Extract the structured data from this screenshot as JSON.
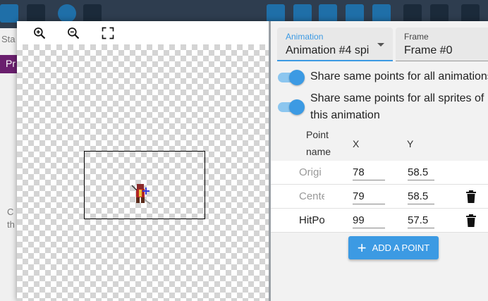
{
  "background": {
    "left_text_top": "Sta",
    "left_purple_text": "Pr",
    "left_text_bottom": "C\nth"
  },
  "preview": {
    "toolbar": [
      {
        "name": "zoom-in-icon"
      },
      {
        "name": "zoom-out-icon"
      },
      {
        "name": "fit-screen-icon"
      }
    ]
  },
  "animation_select": {
    "label": "Animation",
    "value": "Animation #4 spi"
  },
  "frame_select": {
    "label": "Frame",
    "value": "Frame #0"
  },
  "toggles": [
    {
      "label": "Share same points for all animations",
      "on": true
    },
    {
      "label_line1": "Share same points for all sprites of",
      "label_line2": "this animation",
      "on": true
    }
  ],
  "table": {
    "headers": {
      "name_line1": "Point",
      "name_line2": "name",
      "x": "X",
      "y": "Y"
    },
    "rows": [
      {
        "name": "Origi",
        "x": "78",
        "y": "58.5",
        "deletable": false,
        "muted": true
      },
      {
        "name": "Cente",
        "x": "79",
        "y": "58.5",
        "deletable": true,
        "muted": true
      },
      {
        "name": "HitPo",
        "x": "99",
        "y": "57.5",
        "deletable": true,
        "muted": false
      }
    ]
  },
  "add_button": {
    "label": "ADD A POINT"
  },
  "colors": {
    "accent": "#3c9ae3",
    "toggle_track": "#8cc6ef",
    "toolbar_bg": "#2e3d4f"
  }
}
